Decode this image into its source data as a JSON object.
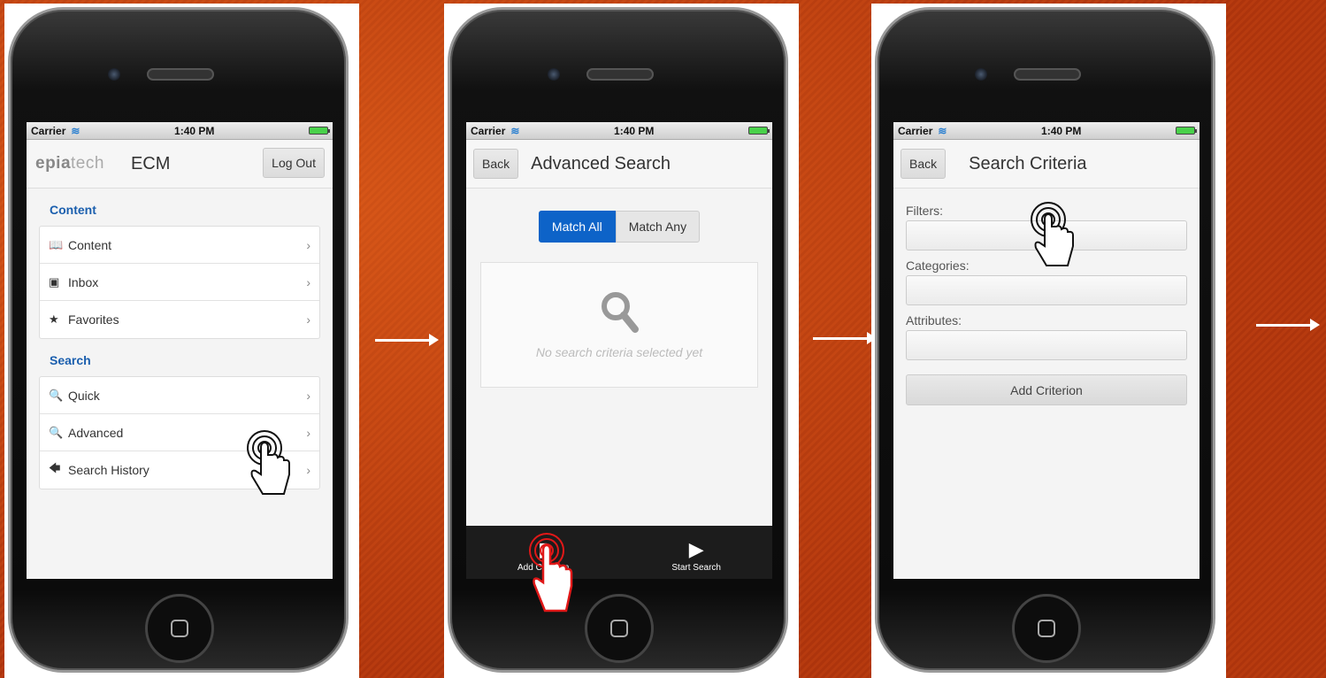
{
  "status_bar": {
    "carrier": "Carrier",
    "time": "1:40 PM"
  },
  "screen1": {
    "logo_dark": "epia",
    "logo_light": "tech",
    "app_title": "ECM",
    "logout_label": "Log Out",
    "content_section_title": "Content",
    "content_items": [
      {
        "label": "Content",
        "icon": "book-icon"
      },
      {
        "label": "Inbox",
        "icon": "inbox-icon"
      },
      {
        "label": "Favorites",
        "icon": "star-icon"
      }
    ],
    "search_section_title": "Search",
    "search_items": [
      {
        "label": "Quick",
        "icon": "search-icon"
      },
      {
        "label": "Advanced",
        "icon": "search-icon"
      },
      {
        "label": "Search History",
        "icon": "back-arrow-icon"
      }
    ]
  },
  "screen2": {
    "back_label": "Back",
    "title": "Advanced Search",
    "match_all_label": "Match All",
    "match_any_label": "Match Any",
    "empty_message": "No search criteria selected yet",
    "tabs": {
      "add_criterion": "Add Criterion",
      "start_search": "Start Search"
    }
  },
  "screen3": {
    "back_label": "Back",
    "title": "Search Criteria",
    "filters_label": "Filters:",
    "categories_label": "Categories:",
    "attributes_label": "Attributes:",
    "add_criterion_label": "Add Criterion"
  },
  "colors": {
    "accent_blue": "#0d63c8",
    "section_blue": "#1b5fae",
    "background_orange": "#c94a12"
  }
}
